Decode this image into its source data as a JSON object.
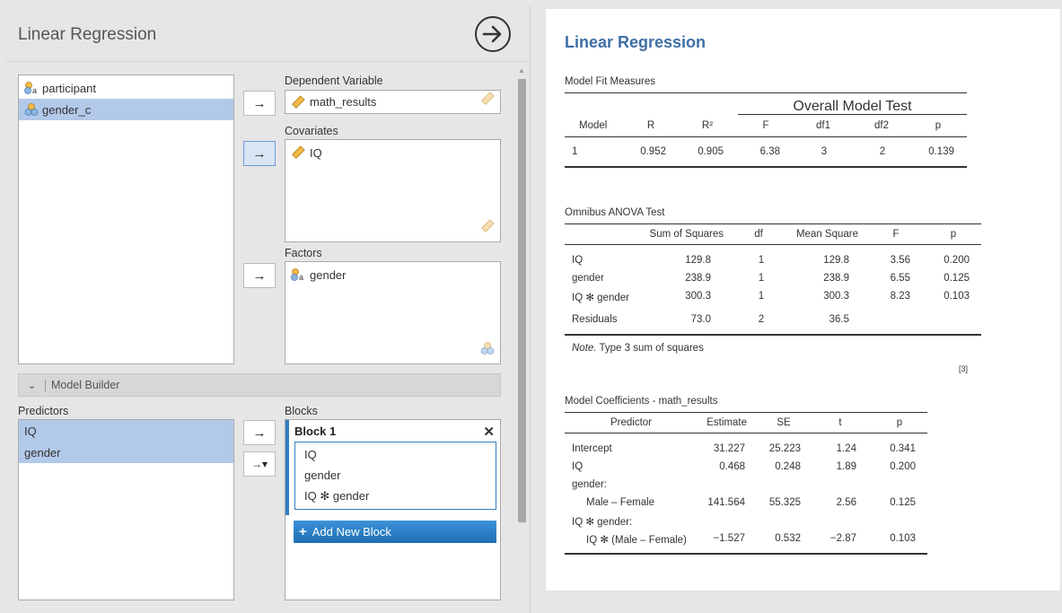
{
  "left": {
    "title": "Linear Regression",
    "variables": [
      {
        "name": "participant",
        "icon": "nominal-text-icon",
        "selected": false
      },
      {
        "name": "gender_c",
        "icon": "nominal-icon",
        "selected": true
      }
    ],
    "dependent_label": "Dependent Variable",
    "dependent_value": "math_results",
    "covariates_label": "Covariates",
    "covariates": [
      "IQ"
    ],
    "factors_label": "Factors",
    "factors": [
      "gender"
    ],
    "model_builder_label": "Model Builder",
    "predictors_label": "Predictors",
    "predictors": [
      "IQ",
      "gender"
    ],
    "blocks_label": "Blocks",
    "block1_title": "Block 1",
    "block1_terms": [
      "IQ",
      "gender",
      "IQ ✻ gender"
    ],
    "add_block_label": "Add New Block",
    "arrow": "→",
    "arrow_dropdown": "→▾"
  },
  "results": {
    "title": "Linear Regression",
    "fit": {
      "label": "Model Fit Measures",
      "overall": "Overall Model Test",
      "headers": [
        "Model",
        "R",
        "R²",
        "F",
        "df1",
        "df2",
        "p"
      ],
      "row": [
        "1",
        "0.952",
        "0.905",
        "6.38",
        "3",
        "2",
        "0.139"
      ]
    },
    "anova": {
      "label": "Omnibus ANOVA Test",
      "headers": [
        "Sum of Squares",
        "df",
        "Mean Square",
        "F",
        "p"
      ],
      "rows": [
        {
          "name": "IQ",
          "ss": "129.8",
          "df": "1",
          "ms": "129.8",
          "f": "3.56",
          "p": "0.200"
        },
        {
          "name": "gender",
          "ss": "238.9",
          "df": "1",
          "ms": "238.9",
          "f": "6.55",
          "p": "0.125"
        },
        {
          "name": "IQ ✻ gender",
          "ss": "300.3",
          "df": "1",
          "ms": "300.3",
          "f": "8.23",
          "p": "0.103"
        },
        {
          "name": "Residuals",
          "ss": "73.0",
          "df": "2",
          "ms": "36.5",
          "f": "",
          "p": ""
        }
      ],
      "note_prefix": "Note.",
      "note_text": " Type 3 sum of squares",
      "ref": "[3]"
    },
    "coef": {
      "label": "Model Coefficients - math_results",
      "headers": [
        "Predictor",
        "Estimate",
        "SE",
        "t",
        "p"
      ],
      "rows": [
        {
          "name": "Intercept",
          "est": "31.227",
          "se": "25.223",
          "t": "1.24",
          "p": "0.341",
          "indent": false
        },
        {
          "name": "IQ",
          "est": "0.468",
          "se": "0.248",
          "t": "1.89",
          "p": "0.200",
          "indent": false
        },
        {
          "name": "gender:",
          "est": "",
          "se": "",
          "t": "",
          "p": "",
          "indent": false
        },
        {
          "name": "Male – Female",
          "est": "141.564",
          "se": "55.325",
          "t": "2.56",
          "p": "0.125",
          "indent": true
        },
        {
          "name": "IQ ✻ gender:",
          "est": "",
          "se": "",
          "t": "",
          "p": "",
          "indent": false
        },
        {
          "name": "IQ ✻ (Male – Female)",
          "est": "−1.527",
          "se": "0.532",
          "t": "−2.87",
          "p": "0.103",
          "indent": true
        }
      ]
    }
  }
}
